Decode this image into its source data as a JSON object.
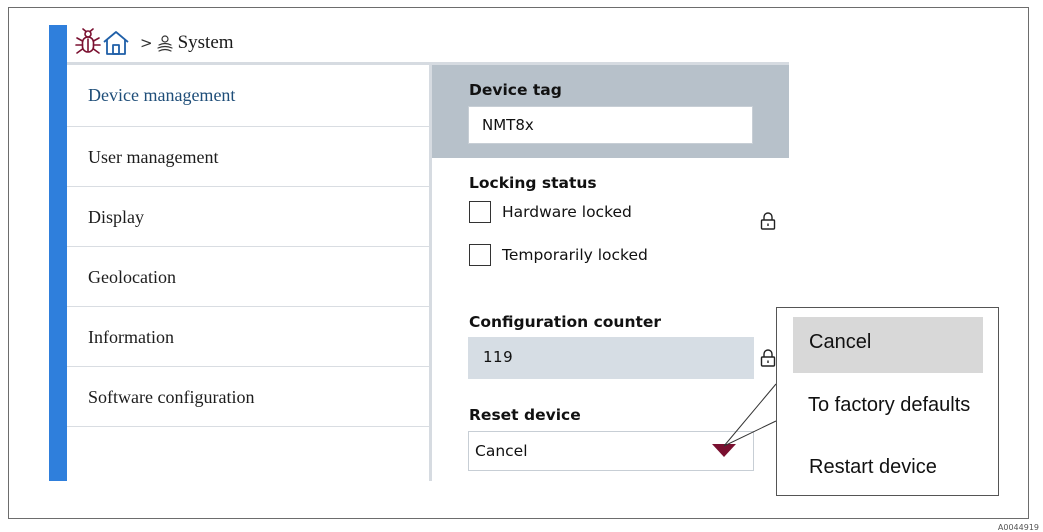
{
  "breadcrumb": {
    "separator": ">",
    "current": "System"
  },
  "icons": {
    "bug": "bug-icon",
    "home": "home-icon",
    "system": "system-icon",
    "lock": "lock-icon",
    "caret": "caret-down-icon"
  },
  "colors": {
    "accent_blue": "#2f7fdc",
    "header_panel": "#b7c1ca",
    "readonly_field": "#d6dde4",
    "caret": "#7a1030",
    "icon_red": "#7a1030",
    "icon_blue": "#1f5fa8",
    "dropdown_selected": "#d8d8d8"
  },
  "sidebar": {
    "items": [
      {
        "label": "Device management",
        "active": true
      },
      {
        "label": "User management",
        "active": false
      },
      {
        "label": "Display",
        "active": false
      },
      {
        "label": "Geolocation",
        "active": false
      },
      {
        "label": "Information",
        "active": false
      },
      {
        "label": "Software configuration",
        "active": false
      }
    ]
  },
  "main": {
    "device_tag": {
      "label": "Device tag",
      "value": "NMT8x"
    },
    "locking_status": {
      "label": "Locking status",
      "options": [
        {
          "label": "Hardware locked",
          "checked": false
        },
        {
          "label": "Temporarily locked",
          "checked": false
        }
      ]
    },
    "configuration_counter": {
      "label": "Configuration counter",
      "value": "119"
    },
    "reset_device": {
      "label": "Reset device",
      "value": "Cancel",
      "options": [
        "Cancel",
        "To factory defaults",
        "Restart device"
      ],
      "selected_index": 0
    }
  },
  "figure_code": "A0044919"
}
